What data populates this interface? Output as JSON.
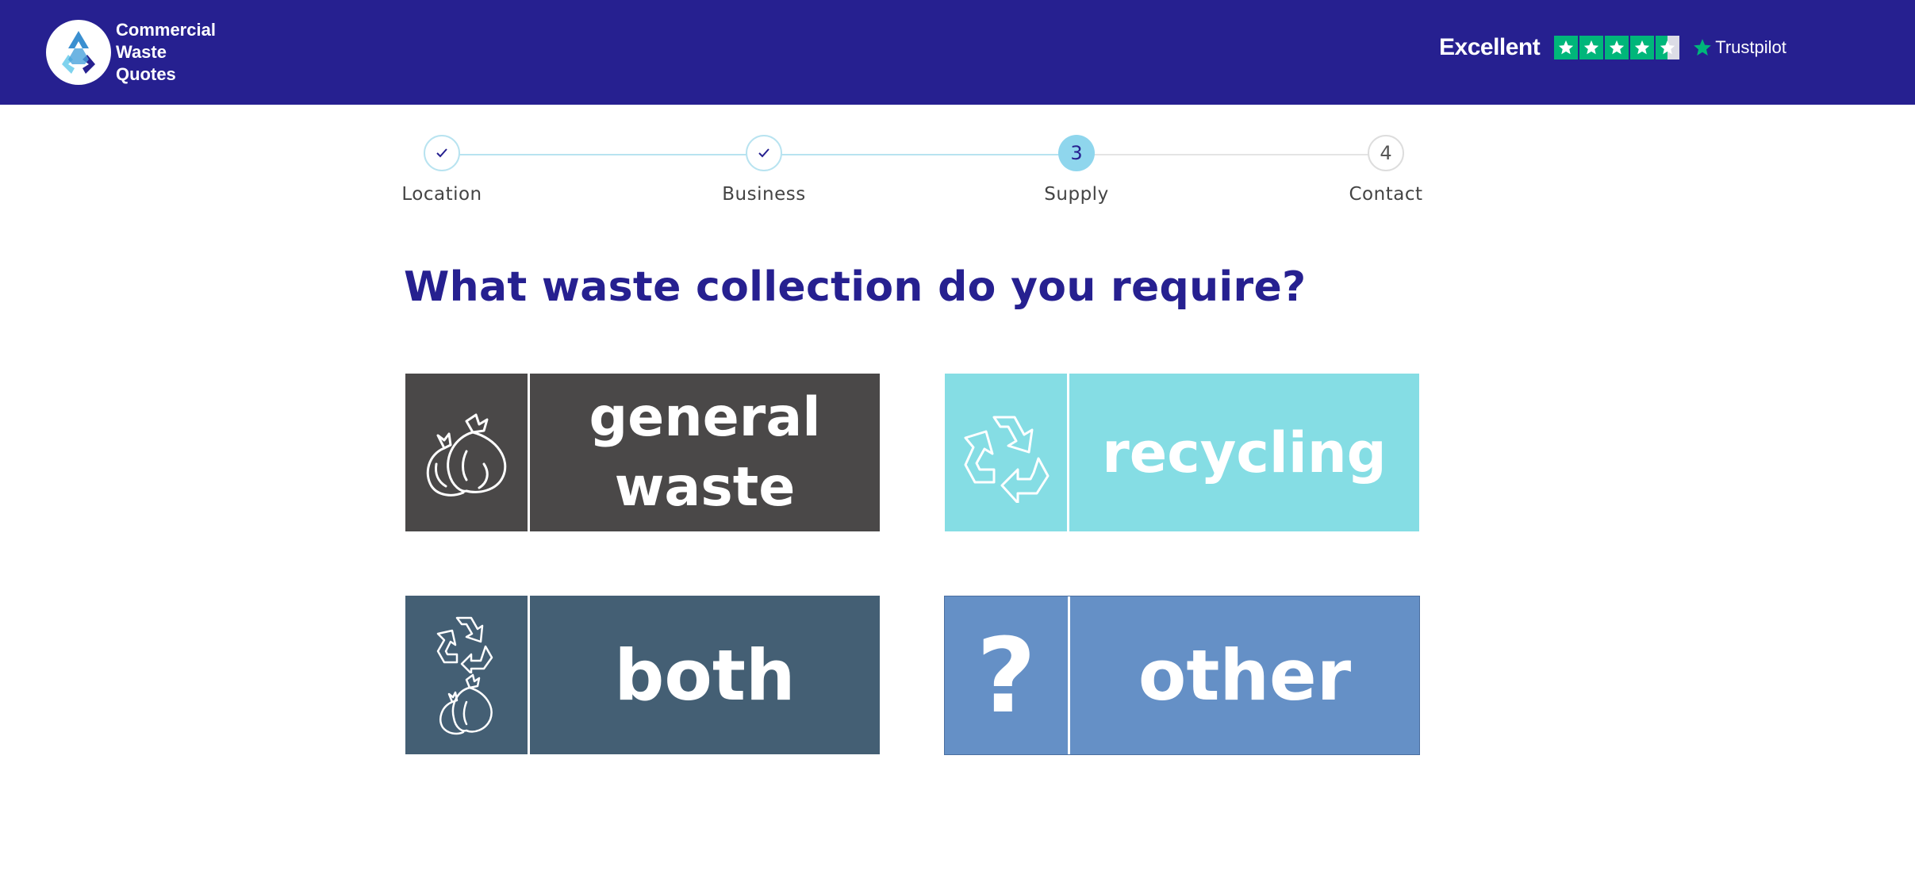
{
  "header": {
    "brand_lines": [
      "Commercial",
      "Waste",
      "Quotes"
    ],
    "rating_label": "Excellent",
    "rating_stars": 4.5,
    "rating_provider": "Trustpilot",
    "colors": {
      "background": "#262090",
      "trustpilot_green": "#00b67a"
    }
  },
  "stepper": {
    "current_step": 3,
    "steps": [
      {
        "label": "Location",
        "marker": "✓",
        "status": "complete"
      },
      {
        "label": "Business",
        "marker": "✓",
        "status": "complete"
      },
      {
        "label": "Supply",
        "marker": "3",
        "status": "active"
      },
      {
        "label": "Contact",
        "marker": "4",
        "status": "upcoming"
      }
    ]
  },
  "question": {
    "title": "What waste collection do you require?"
  },
  "options": {
    "general": {
      "label_line1": "general",
      "label_line2": "waste",
      "icon": "waste-bags-icon",
      "color": "#4a4848"
    },
    "recycling": {
      "label": "recycling",
      "icon": "recycling-arrows-icon",
      "color": "#85dde4"
    },
    "both": {
      "label": "both",
      "icon": "recycling-and-bags-icon",
      "color": "#445f74"
    },
    "other": {
      "label": "other",
      "icon_glyph": "?",
      "icon": "question-mark-icon",
      "color": "#6590c6"
    }
  }
}
